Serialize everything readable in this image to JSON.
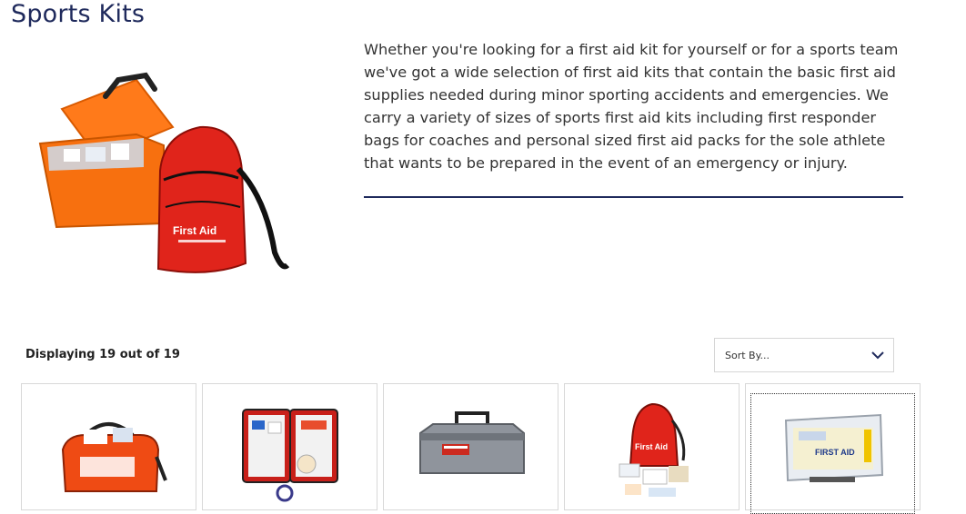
{
  "page": {
    "title": "Sports Kits",
    "description": "Whether you're looking for a first aid kit for yourself or for a sports team we've got a wide selection of first aid kits that contain the basic first aid supplies needed during minor sporting accidents and emergencies. We carry a variety of sizes of sports first aid kits including first responder bags for coaches and personal sized first aid packs for the sole athlete that wants to be prepared in the event of an emergency or injury.",
    "hero_bag_label": "First Aid"
  },
  "listing": {
    "count_text": "Displaying 19 out of 19",
    "sort_label": "Sort By..."
  },
  "products": [
    {
      "icon": "orange-duffel-first-aid-bag"
    },
    {
      "icon": "open-red-first-aid-case"
    },
    {
      "icon": "gray-first-aid-toolbox"
    },
    {
      "icon": "red-sling-first-aid-pack",
      "label": "First Aid"
    },
    {
      "icon": "clear-plastic-first-aid-box",
      "label": "FIRST AID"
    }
  ],
  "colors": {
    "title": "#1f2a5c",
    "rule": "#1f2a5c",
    "kit_red": "#e0241b",
    "kit_orange": "#f26a10"
  }
}
